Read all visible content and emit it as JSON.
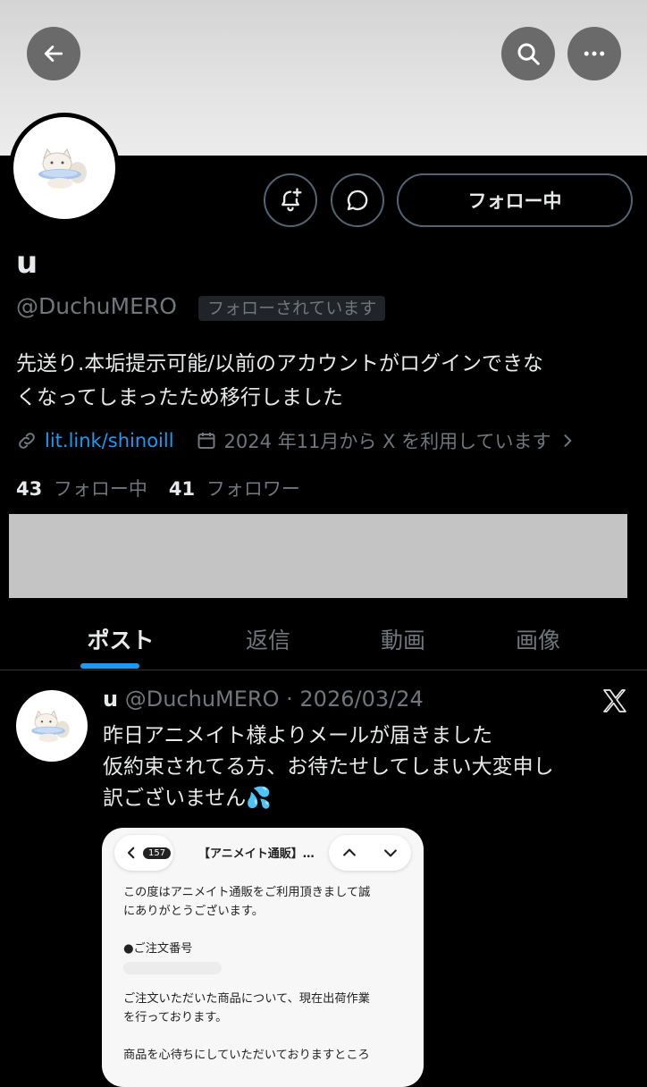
{
  "header": {
    "back_icon": "arrow-left-icon",
    "search_icon": "search-icon",
    "more_icon": "more-horizontal-icon"
  },
  "profile": {
    "name": "u",
    "handle": "@DuchuMERO",
    "follows_you_badge": "フォローされています",
    "bio_line1": "先送り.本垢提示可能/以前のアカウントがログインできな",
    "bio_line2": "くなってしまったため移行しました",
    "link": "lit.link/shinoill",
    "joined": "2024 年11月から X を利用しています",
    "following_count": "43",
    "following_label": "フォロー中",
    "followers_count": "41",
    "followers_label": "フォロワー"
  },
  "actions": {
    "follow_button_label": "フォロー中"
  },
  "tabs": [
    {
      "label": "ポスト",
      "active": true
    },
    {
      "label": "返信",
      "active": false
    },
    {
      "label": "動画",
      "active": false
    },
    {
      "label": "画像",
      "active": false
    }
  ],
  "tweet": {
    "name": "u",
    "handle": "@DuchuMERO",
    "separator": "·",
    "date": "2026/03/24",
    "line1": "昨日アニメイト様よりメールが届きました",
    "line2": "仮約束されてる方、お待たせしてしまい大変申し",
    "line3": "訳ございません💦",
    "embed": {
      "badge_count": "157",
      "subject": "【アニメイト通販】…",
      "body_line1": "この度はアニメイト通販をご利用頂きまして誠",
      "body_line2": "にありがとうございます。",
      "order_heading": "●ご注文番号",
      "body_line3": "ご注文いただいた商品について、現在出荷作業",
      "body_line4": "を行っております。",
      "body_line5": "商品を心待ちにしていただいておりますところ"
    }
  },
  "colors": {
    "background": "#000000",
    "accent": "#1d9bf0",
    "text_primary": "#e7e9ea",
    "text_secondary": "#71767b",
    "border": "#536471"
  }
}
